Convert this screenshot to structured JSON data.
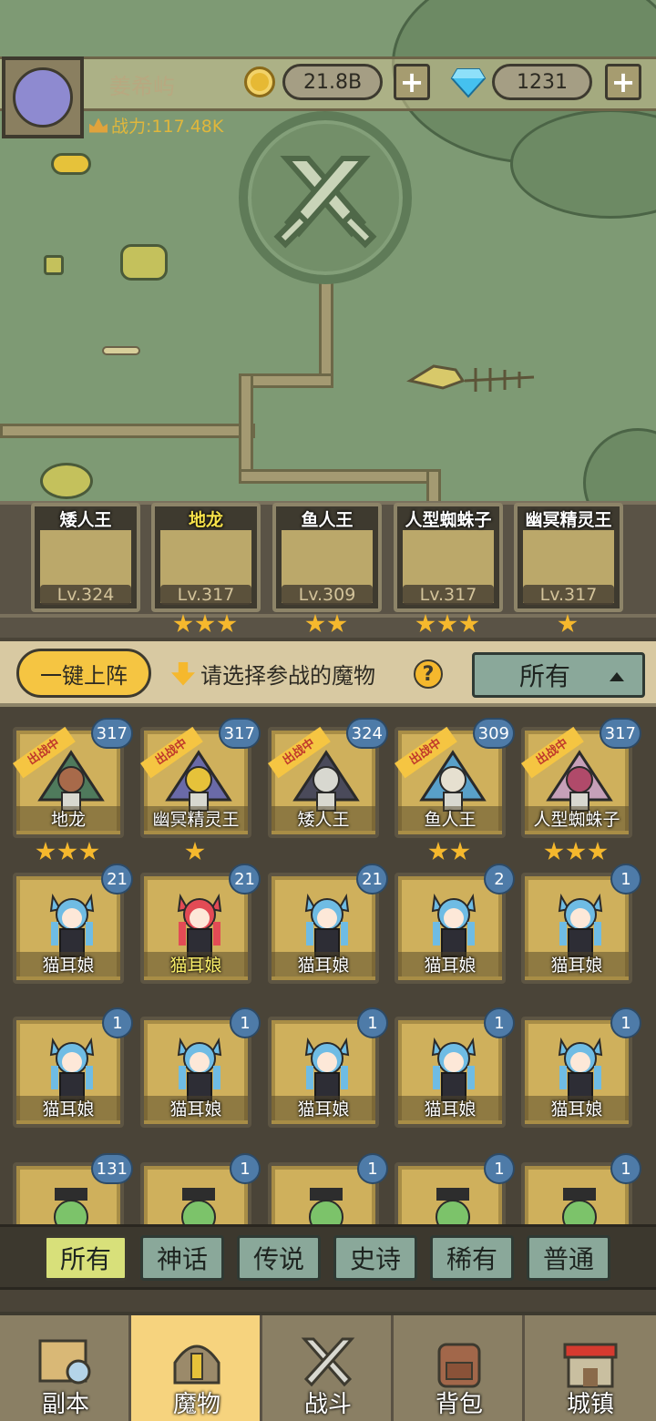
{
  "player": {
    "name": "姜希屿",
    "gold": "21.8B",
    "gems": "1231",
    "power": "战力:117.48K"
  },
  "lineup": [
    {
      "name": "矮人王",
      "level": "Lv.324",
      "stars": 0,
      "highlight": false
    },
    {
      "name": "地龙",
      "level": "Lv.317",
      "stars": 3,
      "highlight": true
    },
    {
      "name": "鱼人王",
      "level": "Lv.309",
      "stars": 2,
      "highlight": false
    },
    {
      "name": "人型蜘蛛子",
      "level": "Lv.317",
      "stars": 3,
      "highlight": false
    },
    {
      "name": "幽冥精灵王",
      "level": "Lv.317",
      "stars": 1,
      "highlight": false
    }
  ],
  "actions": {
    "deploy_label": "一键上阵",
    "hint": "请选择参战的魔物",
    "help": "?",
    "filter_value": "所有"
  },
  "monsters": {
    "deployed_ribbon": "出战中",
    "row1": [
      {
        "name": "地龙",
        "count": "317",
        "stars": 3,
        "deployed": true
      },
      {
        "name": "幽冥精灵王",
        "count": "317",
        "stars": 1,
        "deployed": true
      },
      {
        "name": "矮人王",
        "count": "324",
        "stars": 0,
        "deployed": true
      },
      {
        "name": "鱼人王",
        "count": "309",
        "stars": 2,
        "deployed": true
      },
      {
        "name": "人型蜘蛛子",
        "count": "317",
        "stars": 3,
        "deployed": true
      }
    ],
    "row2": [
      {
        "name": "猫耳娘",
        "count": "21",
        "highlight": false
      },
      {
        "name": "猫耳娘",
        "count": "21",
        "highlight": true
      },
      {
        "name": "猫耳娘",
        "count": "21",
        "highlight": false
      },
      {
        "name": "猫耳娘",
        "count": "2",
        "highlight": false
      },
      {
        "name": "猫耳娘",
        "count": "1",
        "highlight": false
      }
    ],
    "row3": [
      {
        "name": "猫耳娘",
        "count": "1"
      },
      {
        "name": "猫耳娘",
        "count": "1"
      },
      {
        "name": "猫耳娘",
        "count": "1"
      },
      {
        "name": "猫耳娘",
        "count": "1"
      },
      {
        "name": "猫耳娘",
        "count": "1"
      }
    ],
    "row4": [
      {
        "count": "131"
      },
      {
        "count": "1"
      },
      {
        "count": "1"
      },
      {
        "count": "1"
      },
      {
        "count": "1"
      }
    ]
  },
  "rarity_tabs": [
    "所有",
    "神话",
    "传说",
    "史诗",
    "稀有",
    "普通"
  ],
  "nav": [
    "副本",
    "魔物",
    "战斗",
    "背包",
    "城镇"
  ],
  "colors": {
    "accent": "#f5c542",
    "tab": "#8aa89a",
    "active_tab": "#d8e07a",
    "badge": "#4e7ba8"
  }
}
